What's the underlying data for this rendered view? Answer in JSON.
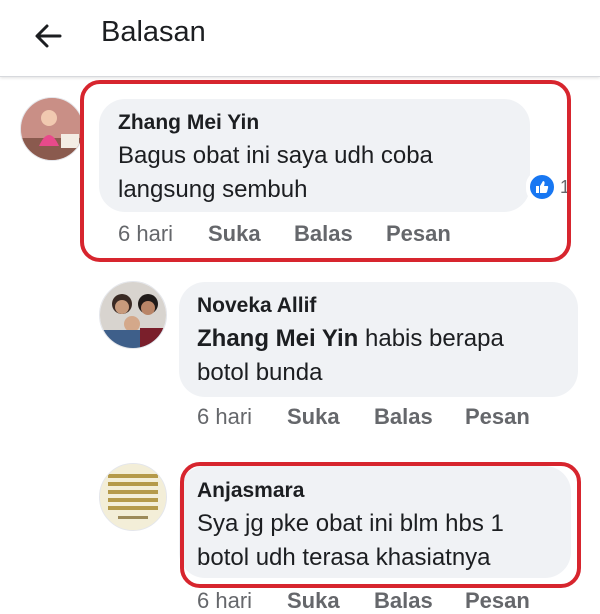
{
  "header": {
    "title": "Balasan",
    "back_icon": "arrow-left-icon"
  },
  "colors": {
    "highlight": "#d7252e",
    "bubble": "#f0f2f5",
    "like": "#1877f2",
    "meta": "#65676b"
  },
  "comments": [
    {
      "author": "Zhang Mei Yin",
      "text": "Bagus obat ini saya udh coba langsung sembuh",
      "time": "6 hari",
      "like_label": "Suka",
      "reply_label": "Balas",
      "message_label": "Pesan",
      "reaction_count": "1",
      "highlighted": true
    },
    {
      "author": "Noveka Allif",
      "mention": "Zhang Mei Yin",
      "text": "habis berapa botol bunda",
      "time": "6 hari",
      "like_label": "Suka",
      "reply_label": "Balas",
      "message_label": "Pesan",
      "highlighted": false
    },
    {
      "author": "Anjasmara",
      "text": "Sya jg pke obat ini blm hbs 1 botol udh terasa khasiatnya",
      "time": "6 hari",
      "like_label": "Suka",
      "reply_label": "Balas",
      "message_label": "Pesan",
      "highlighted": true
    }
  ]
}
